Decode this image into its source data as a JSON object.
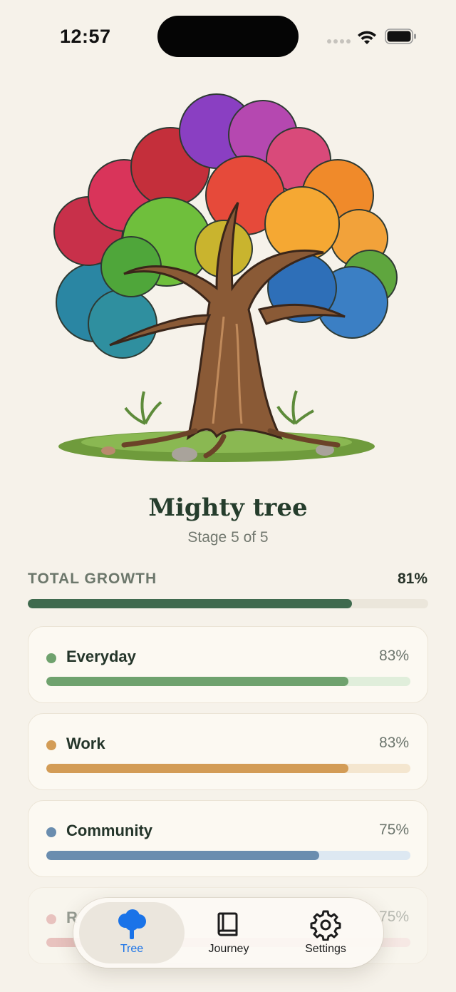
{
  "status_bar": {
    "time": "12:57"
  },
  "stage": {
    "title": "Mighty tree",
    "subtitle": "Stage 5 of 5"
  },
  "total_growth": {
    "label": "TOTAL GROWTH",
    "value": "81%",
    "fraction": 0.81
  },
  "categories": [
    {
      "name": "Everyday",
      "percent": "83%",
      "fraction": 0.83,
      "color": "#6fa26e",
      "track": "#e0eedb"
    },
    {
      "name": "Work",
      "percent": "83%",
      "fraction": 0.83,
      "color": "#d39c56",
      "track": "#f4e6cf"
    },
    {
      "name": "Community",
      "percent": "75%",
      "fraction": 0.75,
      "color": "#6a8daf",
      "track": "#dde8f2"
    },
    {
      "name": "R",
      "percent": "75%",
      "fraction": 0.75,
      "color": "#d98a8a",
      "track": "#f6dede"
    }
  ],
  "tabs": [
    {
      "label": "Tree",
      "icon": "tree-icon",
      "active": true
    },
    {
      "label": "Journey",
      "icon": "book-icon",
      "active": false
    },
    {
      "label": "Settings",
      "icon": "gear-icon",
      "active": false
    }
  ],
  "colors": {
    "accent": "#1a73e8",
    "total_bar": "#3f6a4e"
  }
}
